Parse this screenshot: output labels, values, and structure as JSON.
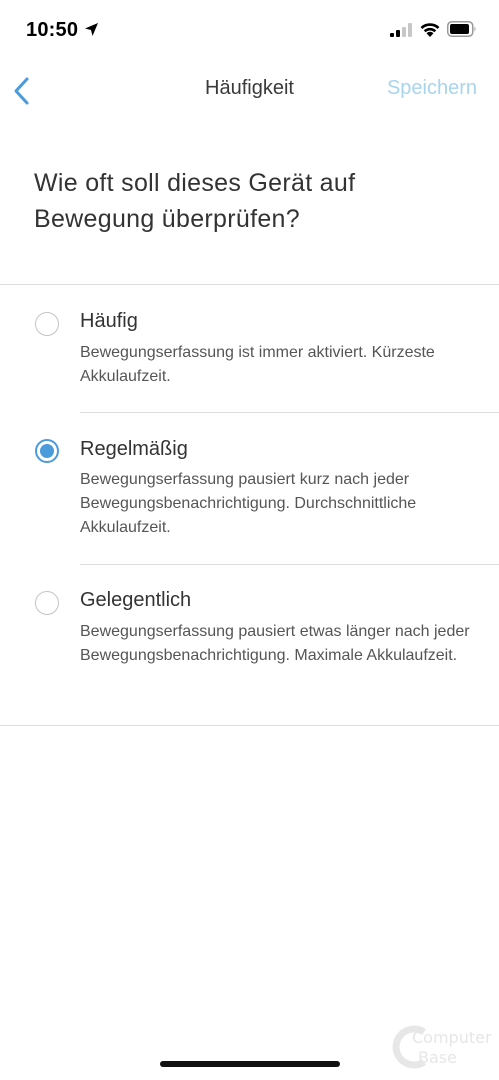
{
  "status_bar": {
    "time": "10:50"
  },
  "nav": {
    "title": "Häufigkeit",
    "save_label": "Speichern"
  },
  "question": "Wie oft soll dieses Gerät auf Bewegung überprüfen?",
  "options": [
    {
      "title": "Häufig",
      "description": "Bewegungserfassung ist immer aktiviert. Kürzeste Akkulaufzeit.",
      "selected": false
    },
    {
      "title": "Regelmäßig",
      "description": "Bewegungserfassung pausiert kurz nach jeder Bewegungsbenachrichtigung. Durchschnittliche Akkulaufzeit.",
      "selected": true
    },
    {
      "title": "Gelegentlich",
      "description": "Bewegungserfassung pausiert etwas länger nach jeder Bewegungsbenachrichtigung. Maximale Akkulaufzeit.",
      "selected": false
    }
  ],
  "watermark": {
    "line1": "Computer",
    "line2": "Base"
  },
  "colors": {
    "accent": "#4a9bdc",
    "save_disabled": "#a8d4ee",
    "back_arrow": "#4a9bdc"
  }
}
